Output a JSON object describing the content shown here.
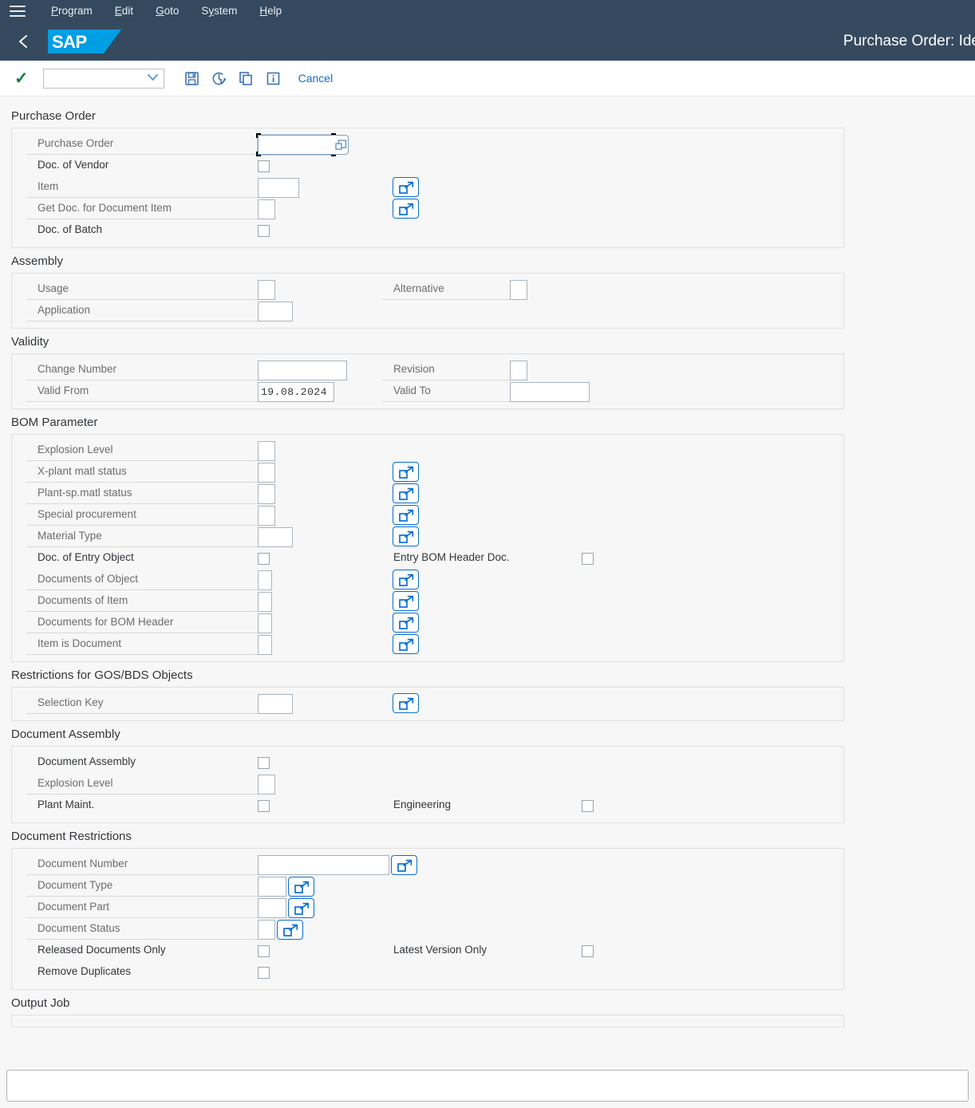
{
  "menubar": {
    "hamburger_icon": "hamburger-icon",
    "items": [
      {
        "label": "Program",
        "accel": "P"
      },
      {
        "label": "Edit",
        "accel": "E"
      },
      {
        "label": "Goto",
        "accel": "G"
      },
      {
        "label": "System",
        "accel": "y"
      },
      {
        "label": "Help",
        "accel": "H"
      }
    ]
  },
  "shellbar": {
    "back_icon": "back-chevron-icon",
    "logo_text": "SAP",
    "title": "Purchase Order: Ide"
  },
  "toolbar": {
    "execute_icon": "checkmark-icon",
    "variant_value": "",
    "variant_chevron_icon": "chevron-down-icon",
    "save_icon": "save-icon",
    "history_icon": "clock-check-icon",
    "copy_icon": "copy-icon",
    "info_icon": "info-icon",
    "cancel_label": "Cancel"
  },
  "sections": [
    {
      "title": "Purchase Order",
      "rows": [
        {
          "label": "Purchase Order",
          "type": "input",
          "width": "w-96",
          "focused": true,
          "attach": true,
          "labelw": "lw-290"
        },
        {
          "label": "Doc. of Vendor",
          "type": "checkbox",
          "labelw": "lw-290"
        },
        {
          "label": "Item",
          "type": "input",
          "width": "w-52",
          "ms": true,
          "labelw": "lw-290"
        },
        {
          "label": "Get Doc. for Document Item",
          "type": "input",
          "width": "w-22",
          "ms": true,
          "labelw": "lw-290"
        },
        {
          "label": "Doc. of Batch",
          "type": "checkbox",
          "labelw": "lw-290"
        }
      ]
    },
    {
      "title": "Assembly",
      "rows": [
        {
          "label": "Usage",
          "type": "input",
          "width": "w-22",
          "labelw": "lw-290",
          "right": {
            "label": "Alternative",
            "type": "input",
            "width": "w-22",
            "labelw": "lw-160"
          }
        },
        {
          "label": "Application",
          "type": "input",
          "width": "w-44",
          "labelw": "lw-290"
        }
      ]
    },
    {
      "title": "Validity",
      "rows": [
        {
          "label": "Change Number",
          "type": "input",
          "width": "w-112",
          "labelw": "lw-290",
          "right": {
            "label": "Revision",
            "type": "input",
            "width": "w-22",
            "labelw": "lw-160"
          }
        },
        {
          "label": "Valid From",
          "type": "input",
          "width": "w-96",
          "value": "19.08.2024",
          "labelw": "lw-290",
          "right": {
            "label": "Valid To",
            "type": "input",
            "width": "w-100",
            "labelw": "lw-160"
          }
        }
      ]
    },
    {
      "title": "BOM Parameter",
      "rows": [
        {
          "label": "Explosion Level",
          "type": "input",
          "width": "w-22",
          "labelw": "lw-290"
        },
        {
          "label": "X-plant matl status",
          "type": "input",
          "width": "w-22",
          "ms": true,
          "labelw": "lw-290"
        },
        {
          "label": "Plant-sp.matl status",
          "type": "input",
          "width": "w-22",
          "ms": true,
          "labelw": "lw-290"
        },
        {
          "label": "Special procurement",
          "type": "input",
          "width": "w-22",
          "ms": true,
          "labelw": "lw-290"
        },
        {
          "label": "Material Type",
          "type": "input",
          "width": "w-44",
          "ms": true,
          "labelw": "lw-290"
        },
        {
          "label": "Doc. of Entry Object",
          "type": "checkbox",
          "labelw": "lw-290",
          "right": {
            "label": "Entry BOM Header Doc.",
            "type": "checkbox",
            "labelw": "lw-250"
          }
        },
        {
          "label": "Documents of Object",
          "type": "input",
          "width": "w-18",
          "ms": true,
          "labelw": "lw-290"
        },
        {
          "label": "Documents of Item",
          "type": "input",
          "width": "w-18",
          "ms": true,
          "labelw": "lw-290"
        },
        {
          "label": "Documents for BOM Header",
          "type": "input",
          "width": "w-18",
          "ms": true,
          "labelw": "lw-290"
        },
        {
          "label": "Item is Document",
          "type": "input",
          "width": "w-18",
          "ms": true,
          "labelw": "lw-290"
        }
      ]
    },
    {
      "title": "Restrictions for GOS/BDS Objects",
      "rows": [
        {
          "label": "Selection Key",
          "type": "input",
          "width": "w-44",
          "ms": true,
          "labelw": "lw-290"
        }
      ]
    },
    {
      "title": "Document Assembly",
      "rows": [
        {
          "label": "Document Assembly",
          "type": "checkbox",
          "labelw": "lw-290"
        },
        {
          "label": "Explosion Level",
          "type": "input",
          "width": "w-22",
          "labelw": "lw-290"
        },
        {
          "label": "Plant Maint.",
          "type": "checkbox",
          "labelw": "lw-290",
          "right": {
            "label": "Engineering",
            "type": "checkbox",
            "labelw": "lw-250"
          }
        }
      ]
    },
    {
      "title": "Document Restrictions",
      "rows": [
        {
          "label": "Document Number",
          "type": "input",
          "width": "w-165",
          "ms_attached": true,
          "labelw": "lw-290"
        },
        {
          "label": "Document Type",
          "type": "input",
          "width": "w-36",
          "ms_attached": true,
          "labelw": "lw-290"
        },
        {
          "label": "Document Part",
          "type": "input",
          "width": "w-36",
          "ms_attached": true,
          "labelw": "lw-290"
        },
        {
          "label": "Document Status",
          "type": "input",
          "width": "w-22",
          "ms_attached": true,
          "labelw": "lw-290"
        },
        {
          "label": "Released Documents Only",
          "type": "checkbox",
          "labelw": "lw-290",
          "right": {
            "label": "Latest Version Only",
            "type": "checkbox",
            "labelw": "lw-250"
          }
        },
        {
          "label": "Remove Duplicates",
          "type": "checkbox",
          "labelw": "lw-290"
        }
      ]
    },
    {
      "title": "Output Job",
      "rows": []
    }
  ],
  "command_field": {
    "value": "",
    "placeholder": ""
  },
  "colors": {
    "shell_bg": "#354a5f",
    "menu_bg": "#34495e",
    "accent_blue": "#0a6ed1",
    "logo_blue": "#009ee3",
    "success_green": "#107e3e",
    "page_bg": "#f7f7f7"
  }
}
